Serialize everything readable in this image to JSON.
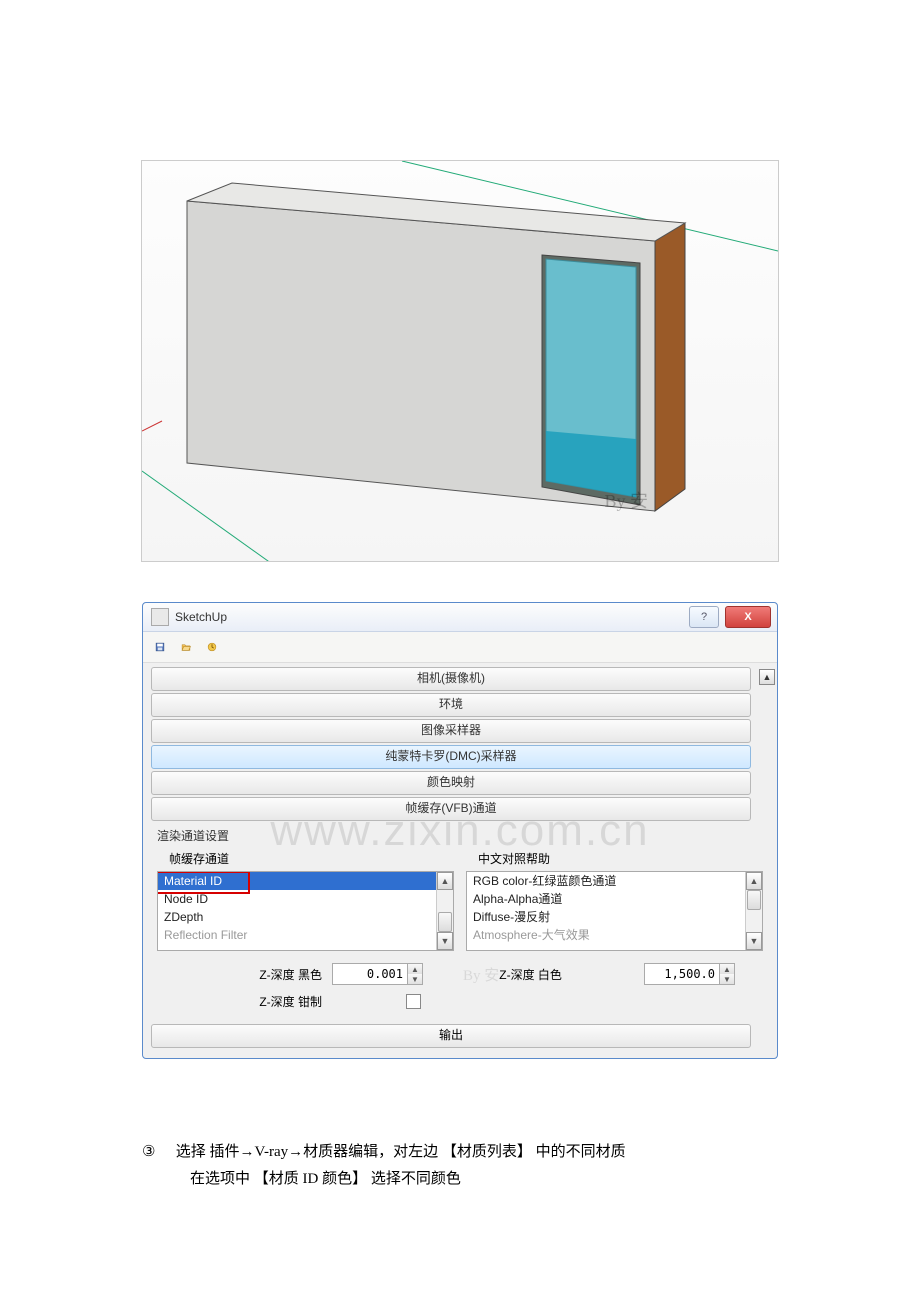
{
  "viewport_watermark": "www.zixin.com.cn",
  "by_tag_1": "By 安",
  "by_tag_2": "By 安",
  "dialog": {
    "title": "SketchUp",
    "help_btn": "?",
    "close_btn": "X",
    "sections": {
      "camera": "相机(摄像机)",
      "environment": "环境",
      "image_sampler": "图像采样器",
      "dmc_sampler": "纯蒙特卡罗(DMC)采样器",
      "color_mapping": "颜色映射",
      "vfb_channel": "帧缓存(VFB)通道"
    },
    "panel_label": "渲染通道设置",
    "left_col_title": "帧缓存通道",
    "right_col_title": "中文对照帮助",
    "left_items": [
      "Material ID",
      "Node ID",
      "ZDepth",
      "Reflection Filter"
    ],
    "right_items": [
      "RGB color-红绿蓝颜色通道",
      "Alpha-Alpha通道",
      "Diffuse-漫反射",
      "Atmosphere-大气效果"
    ],
    "z_black_label": "Z-深度 黑色",
    "z_black_value": "0.001",
    "z_white_label": "Z-深度 白色",
    "z_white_value": "1,500.0",
    "z_clamp_label": "Z-深度 钳制",
    "output_btn": "输出"
  },
  "instruction": {
    "num": "③",
    "line1": "选择 插件→V-ray→材质器编辑，对左边 【材质列表】 中的不同材质",
    "line2": "在选项中 【材质 ID 颜色】 选择不同颜色"
  }
}
